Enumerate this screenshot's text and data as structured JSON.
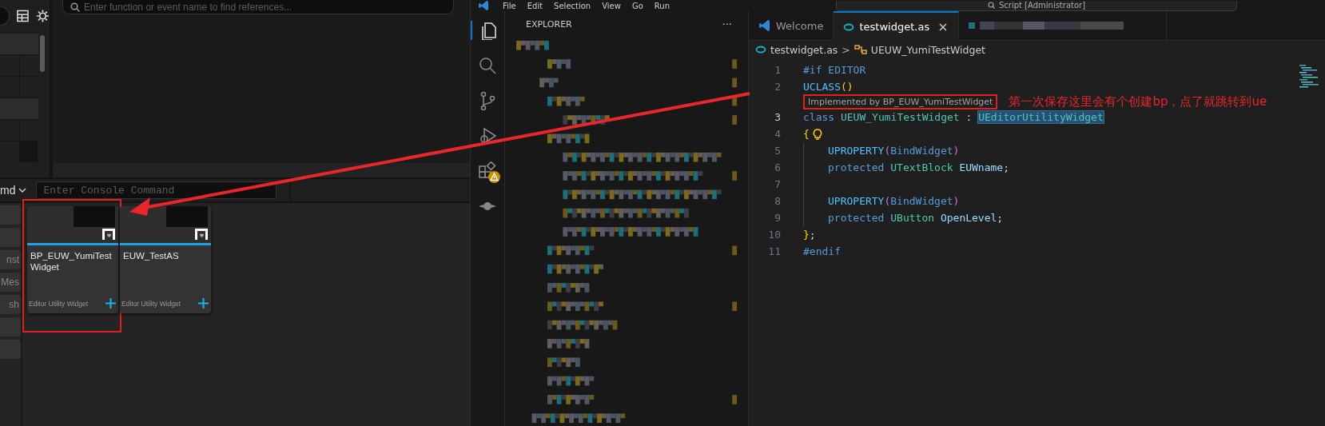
{
  "unreal": {
    "find_field": {
      "placeholder": "Enter function or event name to find references..."
    },
    "console": {
      "label": "md",
      "placeholder": "Enter Console Command"
    },
    "side_buttons": [
      {
        "kind": "blank"
      },
      {
        "kind": "blank"
      },
      {
        "kind": "text",
        "text": "nst"
      },
      {
        "kind": "text",
        "text": "Mes"
      },
      {
        "kind": "text",
        "text": "sh"
      },
      {
        "kind": "blank"
      },
      {
        "kind": "blank"
      }
    ],
    "assets": [
      {
        "name": "BP_EUW_YumiTestWidget",
        "type": "Editor Utility Widget",
        "annotated": true
      },
      {
        "name": "EUW_TestAS",
        "type": "Editor Utility Widget",
        "annotated": false
      }
    ]
  },
  "vscode": {
    "menu": [
      "File",
      "Edit",
      "Selection",
      "View",
      "Go",
      "Run"
    ],
    "command_center": "Script [Administrator]",
    "activity_bar": [
      {
        "kind": "explorer",
        "selected": true,
        "warning": false
      },
      {
        "kind": "search",
        "selected": false,
        "warning": false
      },
      {
        "kind": "source-control",
        "selected": false,
        "warning": false
      },
      {
        "kind": "run-debug",
        "selected": false,
        "warning": false
      },
      {
        "kind": "extensions",
        "selected": false,
        "warning": true
      },
      {
        "kind": "plugin",
        "selected": false,
        "warning": false
      }
    ],
    "explorer": {
      "title": "EXPLORER",
      "more": "···"
    },
    "tabs": [
      {
        "kind": "welcome",
        "label": "Welcome",
        "selected": false
      },
      {
        "kind": "file",
        "label": "testwidget.as",
        "selected": true,
        "close": "×"
      },
      {
        "kind": "blurred",
        "selected": false
      }
    ],
    "breadcrumb": {
      "file": "testwidget.as",
      "separator": ">",
      "symbol": "UEUW_YumiTestWidget"
    },
    "code": [
      {
        "kind": "line",
        "number": "1",
        "current": false,
        "indented": false,
        "tokens": [
          {
            "text": "#if EDITOR",
            "kind": "keyword"
          }
        ]
      },
      {
        "kind": "line",
        "number": "2",
        "current": false,
        "indented": false,
        "tokens": [
          {
            "text": "UCLASS",
            "kind": "macro"
          },
          {
            "text": "()",
            "kind": "bracket"
          }
        ]
      },
      {
        "kind": "codelens",
        "text": "Implemented by BP_EUW_YumiTestWidget",
        "annotated": true
      },
      {
        "kind": "line",
        "number": "3",
        "current": true,
        "indented": false,
        "tokens": [
          {
            "text": "class ",
            "kind": "keyword"
          },
          {
            "text": "UEUW_YumiTestWidget",
            "kind": "type"
          },
          {
            "text": " : ",
            "kind": "plain"
          },
          {
            "text": "UEditorUtilityWidget",
            "kind": "type",
            "highlighted": true
          }
        ]
      },
      {
        "kind": "line",
        "number": "4",
        "current": false,
        "indented": false,
        "lightbulb": true,
        "tokens": [
          {
            "text": "{",
            "kind": "bracket"
          }
        ]
      },
      {
        "kind": "line",
        "number": "5",
        "current": false,
        "indented": true,
        "tokens": [
          {
            "text": "UPROPERTY",
            "kind": "macro"
          },
          {
            "text": "(",
            "kind": "bracket2"
          },
          {
            "text": "BindWidget",
            "kind": "keyword"
          },
          {
            "text": ")",
            "kind": "bracket2"
          }
        ]
      },
      {
        "kind": "line",
        "number": "6",
        "current": false,
        "indented": true,
        "tokens": [
          {
            "text": "protected ",
            "kind": "keyword"
          },
          {
            "text": "UTextBlock ",
            "kind": "type"
          },
          {
            "text": "EUWname",
            "kind": "variable"
          },
          {
            "text": ";",
            "kind": "plain"
          }
        ]
      },
      {
        "kind": "line",
        "number": "7",
        "current": false,
        "indented": true
      },
      {
        "kind": "line",
        "number": "8",
        "current": false,
        "indented": true,
        "tokens": [
          {
            "text": "UPROPERTY",
            "kind": "macro"
          },
          {
            "text": "(",
            "kind": "bracket2"
          },
          {
            "text": "BindWidget",
            "kind": "keyword"
          },
          {
            "text": ")",
            "kind": "bracket2"
          }
        ]
      },
      {
        "kind": "line",
        "number": "9",
        "current": false,
        "indented": true,
        "tokens": [
          {
            "text": "protected ",
            "kind": "keyword"
          },
          {
            "text": "UButton ",
            "kind": "type"
          },
          {
            "text": "OpenLevel",
            "kind": "variable"
          },
          {
            "text": ";",
            "kind": "plain"
          }
        ]
      },
      {
        "kind": "line",
        "number": "10",
        "current": false,
        "indented": false,
        "tokens": [
          {
            "text": "}",
            "kind": "bracket"
          },
          {
            "text": ";",
            "kind": "plain"
          }
        ]
      },
      {
        "kind": "line",
        "number": "11",
        "current": false,
        "indented": false,
        "tokens": [
          {
            "text": "#endif",
            "kind": "keyword"
          }
        ]
      }
    ],
    "annotation": {
      "note": "第一次保存这里会有个创建bp，点了就跳转到ue"
    }
  }
}
